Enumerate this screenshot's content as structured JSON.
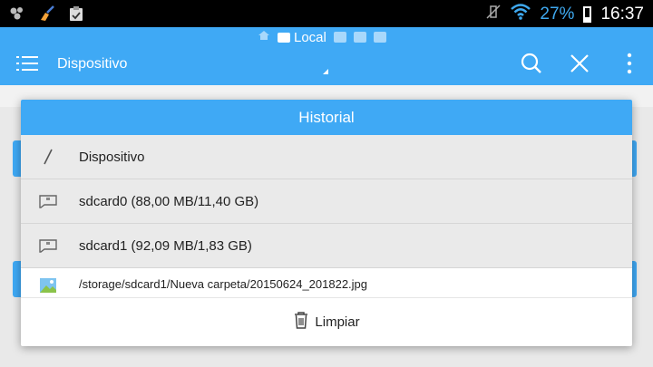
{
  "status_bar": {
    "battery_text": "27%",
    "time": "16:37",
    "icons": [
      "apps-icon",
      "cleaner-icon",
      "clipboard-icon",
      "vibrate-off-icon",
      "wifi-icon",
      "battery-icon"
    ],
    "battery_level": 0.27
  },
  "app_bar": {
    "title": "Dispositivo",
    "location_label": "Local",
    "location_icons": [
      "home-icon",
      "local-icon",
      "network-icon",
      "cloud-icon",
      "tools-icon"
    ]
  },
  "dialog": {
    "title": "Historial",
    "items": [
      {
        "icon": "root-slash-icon",
        "label": "Dispositivo"
      },
      {
        "icon": "sdcard-icon",
        "label": "sdcard0 (88,00 MB/11,40 GB)"
      },
      {
        "icon": "sdcard-icon",
        "label": "sdcard1 (92,09 MB/1,83 GB)"
      },
      {
        "icon": "image-file-icon",
        "label": "/storage/sdcard1/Nueva carpeta/20150624_201822.jpg"
      }
    ],
    "clear_label": "Limpiar"
  },
  "colors": {
    "accent": "#3fa9f5",
    "status_text": "#3fa9ef",
    "list_bg": "#eaeaea"
  }
}
